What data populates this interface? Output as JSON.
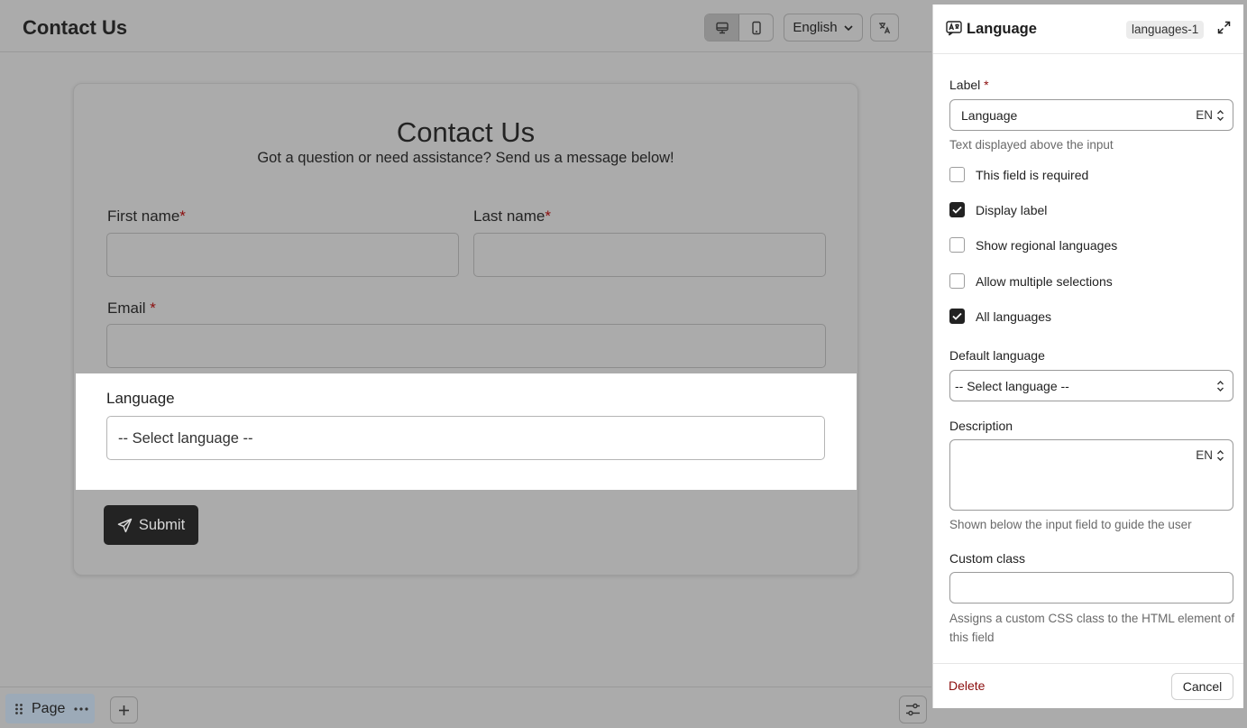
{
  "topbar": {
    "title": "Contact Us",
    "language_selector": "English",
    "icons": [
      "desktop-icon",
      "mobile-icon",
      "chevron-down-icon",
      "translate-icon"
    ]
  },
  "form": {
    "heading": "Contact Us",
    "subheading": "Got a question or need assistance? Send us a message below!",
    "first_name_label": "First name",
    "last_name_label": "Last name",
    "email_label": "Email",
    "required_marker": "*",
    "language_label": "Language",
    "language_placeholder": "-- Select language --",
    "submit_label": "Submit"
  },
  "bottombar": {
    "page_tab_label": "Page"
  },
  "panel": {
    "title": "Language",
    "badge": "languages-1",
    "label_field": {
      "label": "Label",
      "required_marker": "*",
      "value": "Language",
      "locale": "EN",
      "help": "Text displayed above the input"
    },
    "checkboxes": [
      {
        "label": "This field is required",
        "checked": false
      },
      {
        "label": "Display label",
        "checked": true
      },
      {
        "label": "Show regional languages",
        "checked": false
      },
      {
        "label": "Allow multiple selections",
        "checked": false
      },
      {
        "label": "All languages",
        "checked": true
      }
    ],
    "default_language": {
      "label": "Default language",
      "value": "-- Select language --"
    },
    "description": {
      "label": "Description",
      "locale": "EN",
      "help": "Shown below the input field to guide the user"
    },
    "custom_class": {
      "label": "Custom class",
      "help": "Assigns a custom CSS class to the HTML element of this field"
    },
    "footer": {
      "delete_label": "Delete",
      "cancel_label": "Cancel"
    }
  },
  "colors": {
    "overlay_gray": "#ababab",
    "required_red": "#8b0d0d",
    "submit_bg": "#232323",
    "page_tab_bg": "#9caab8"
  }
}
